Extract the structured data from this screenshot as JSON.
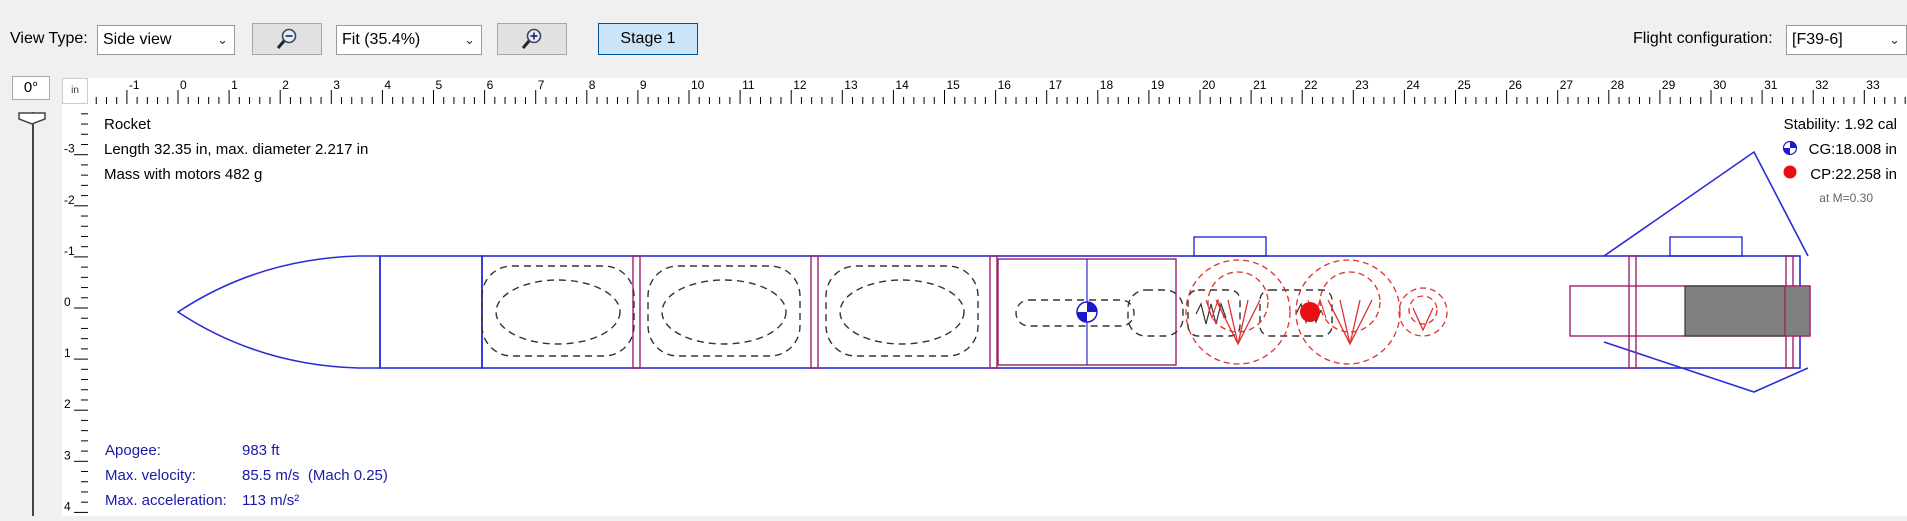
{
  "toolbar": {
    "view_type_label": "View Type:",
    "view_type_value": "Side view",
    "zoom_value": "Fit (35.4%)",
    "stage_label": "Stage 1",
    "flight_config_label": "Flight configuration:",
    "flight_config_value": "[F39-6]"
  },
  "rotation": {
    "angle": "0°"
  },
  "ruler": {
    "unit": "in",
    "top_labels": [
      "-1",
      "0",
      "1",
      "2",
      "3",
      "4",
      "5",
      "6",
      "7",
      "8",
      "9",
      "10",
      "11",
      "12",
      "13",
      "14",
      "15",
      "16",
      "17",
      "18",
      "19",
      "20",
      "21",
      "22",
      "23",
      "24",
      "25",
      "26",
      "27",
      "28",
      "29",
      "30",
      "31",
      "32",
      "33"
    ],
    "left_labels": [
      "-3",
      "-2",
      "-1",
      "0",
      "1",
      "2",
      "3",
      "4"
    ]
  },
  "rocket_info": {
    "name": "Rocket",
    "dimensions": "Length 32.35 in, max. diameter 2.217 in",
    "mass": "Mass with motors 482 g"
  },
  "stability": {
    "label": "Stability:",
    "value": "1.92 cal",
    "cg": "CG:18.008 in",
    "cp": "CP:22.258 in",
    "mach_note": "at M=0.30"
  },
  "flight_data": {
    "apogee_label": "Apogee:",
    "apogee_value": "983 ft",
    "velocity_label": "Max. velocity:",
    "velocity_value": "85.5 m/s  (Mach 0.25)",
    "accel_label": "Max. acceleration:",
    "accel_value": "113 m/s²"
  },
  "colors": {
    "structure": "#2b2bd6",
    "inner": "#a0206a",
    "parachute": "#e03030",
    "mass": "#333333",
    "motor": "#808080"
  }
}
